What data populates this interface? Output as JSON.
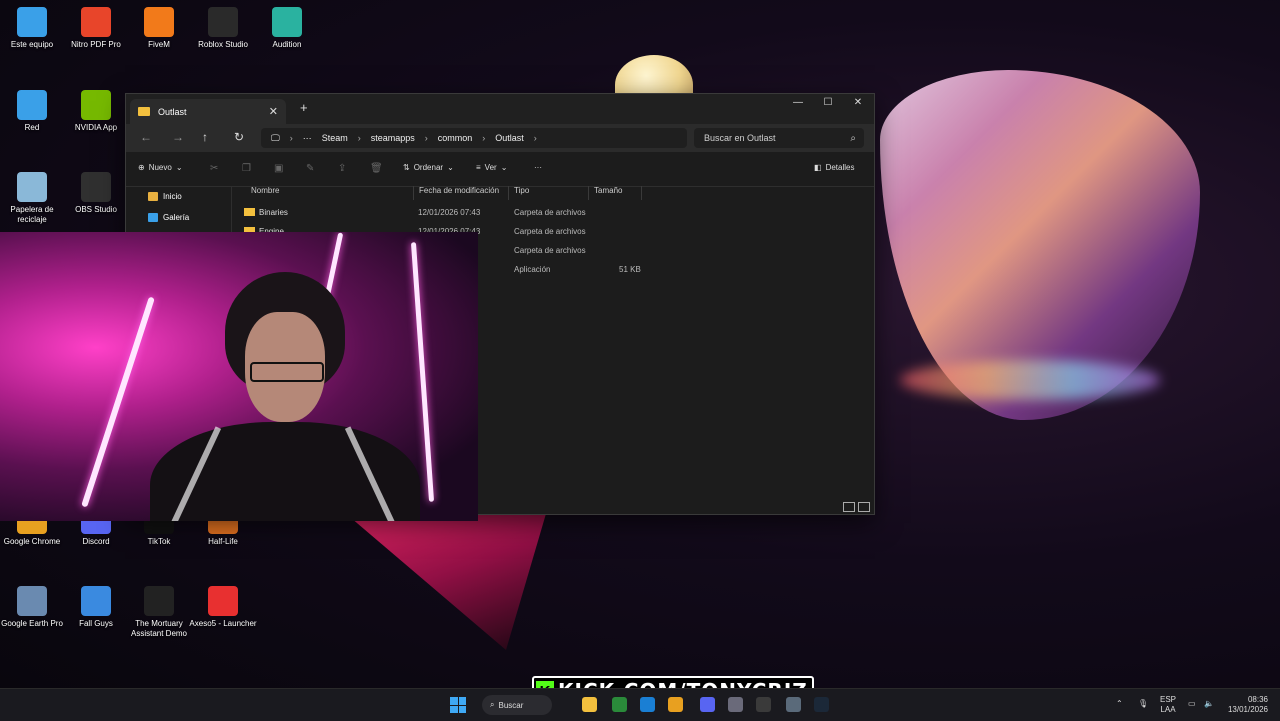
{
  "desktop_icons": [
    {
      "label": "Este equipo",
      "icon": "computer-icon",
      "color": "#3aa0e8"
    },
    {
      "label": "Nitro PDF Pro",
      "icon": "nitro-pdf-icon",
      "color": "#e8452a"
    },
    {
      "label": "FiveM",
      "icon": "fivem-icon",
      "color": "#f27a1a"
    },
    {
      "label": "Roblox Studio",
      "icon": "roblox-studio-icon",
      "color": "#2a2a2a"
    },
    {
      "label": "Audition",
      "icon": "audition-icon",
      "color": "#2ab2a0"
    },
    {
      "label": "Red",
      "icon": "network-icon",
      "color": "#3aa0e8"
    },
    {
      "label": "NVIDIA App",
      "icon": "nvidia-icon",
      "color": "#76b900"
    },
    {
      "label": "Papelera de reciclaje",
      "icon": "recycle-bin-icon",
      "color": "#8ab8d8"
    },
    {
      "label": "OBS Studio",
      "icon": "obs-icon",
      "color": "#303030"
    },
    {
      "label": "Google Chrome",
      "icon": "chrome-icon",
      "color": "#e8a020"
    },
    {
      "label": "Discord",
      "icon": "discord-icon",
      "color": "#5865f2"
    },
    {
      "label": "TikTok",
      "icon": "tiktok-icon",
      "color": "#111111"
    },
    {
      "label": "Half-Life",
      "icon": "half-life-icon",
      "color": "#e07020"
    },
    {
      "label": "Google Earth Pro",
      "icon": "google-earth-icon",
      "color": "#6a8ab0"
    },
    {
      "label": "Fall Guys",
      "icon": "fall-guys-icon",
      "color": "#3a8ae0"
    },
    {
      "label": "The Mortuary Assistant Demo",
      "icon": "mortuary-assistant-icon",
      "color": "#222222"
    },
    {
      "label": "Axeso5 - Launcher",
      "icon": "axeso5-icon",
      "color": "#e83030"
    }
  ],
  "explorer": {
    "tab_title": "Outlast",
    "new_tab": "+",
    "window_controls": {
      "minimize": "—",
      "maximize": "☐",
      "close": "✕"
    },
    "breadcrumbs": [
      "Steam",
      "steamapps",
      "common",
      "Outlast"
    ],
    "search_placeholder": "Buscar en Outlast",
    "toolbar": {
      "new_label": "Nuevo",
      "sort_label": "Ordenar",
      "view_label": "Ver",
      "more": "···",
      "details_label": "Detalles"
    },
    "sidebar": [
      {
        "label": "Inicio",
        "icon": "home-icon"
      },
      {
        "label": "Galería",
        "icon": "gallery-icon"
      }
    ],
    "columns": {
      "name": "Nombre",
      "modified": "Fecha de modificación",
      "type": "Tipo",
      "size": "Tamaño"
    },
    "rows": [
      {
        "name": "Binaries",
        "modified": "12/01/2026 07:43",
        "type": "Carpeta de archivos",
        "size": ""
      },
      {
        "name": "Engine",
        "modified": "12/01/2026 07:43",
        "type": "Carpeta de archivos",
        "size": ""
      },
      {
        "name": "",
        "modified": "",
        "type": "Carpeta de archivos",
        "size": ""
      },
      {
        "name": "",
        "modified": "",
        "type": "Aplicación",
        "size": "51 KB"
      }
    ]
  },
  "taskbar": {
    "search_label": "Buscar",
    "language": "ESP",
    "layout": "LAA",
    "time": "08:36",
    "date": "13/01/2026"
  },
  "overlay": {
    "kick_badge": "K",
    "kick_text": "KICK.COM/TONYCRIZ",
    "brand_color": "#53fc18"
  }
}
